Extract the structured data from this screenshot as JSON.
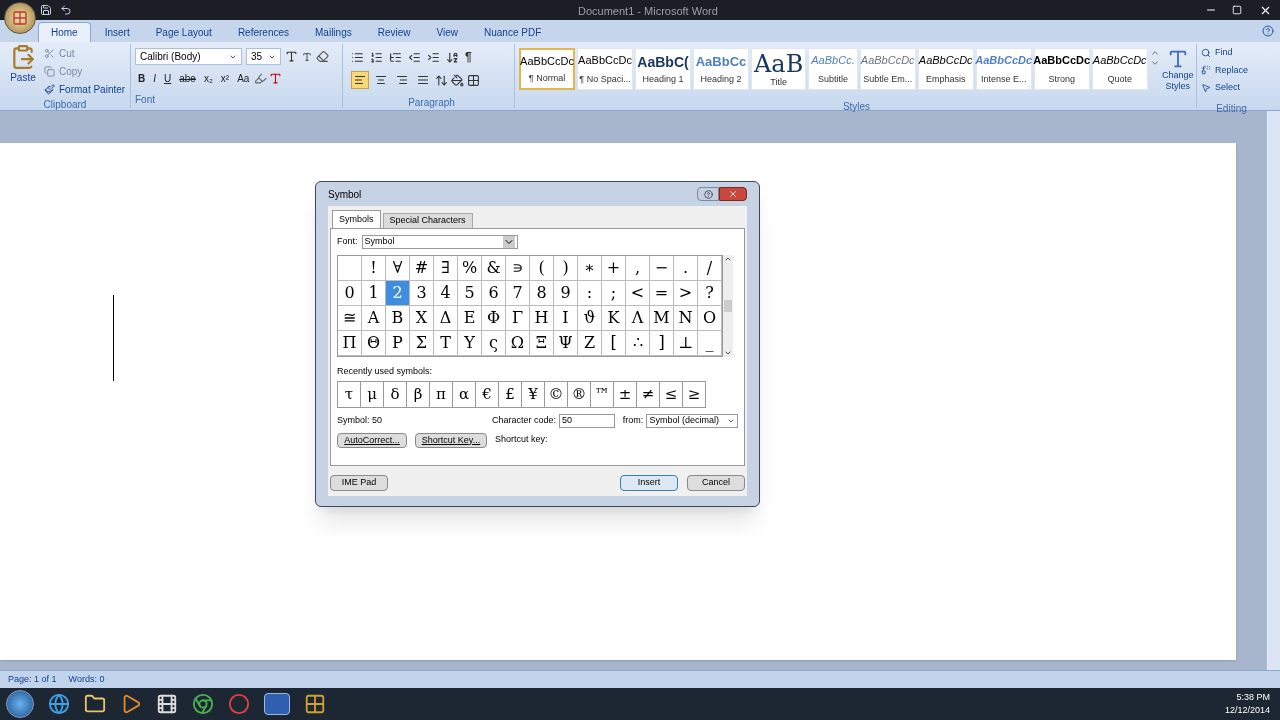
{
  "window": {
    "title": "Document1 - Microsoft Word"
  },
  "ribbon_tabs": [
    {
      "label": "Home",
      "selected": true
    },
    {
      "label": "Insert",
      "selected": false
    },
    {
      "label": "Page Layout",
      "selected": false
    },
    {
      "label": "References",
      "selected": false
    },
    {
      "label": "Mailings",
      "selected": false
    },
    {
      "label": "Review",
      "selected": false
    },
    {
      "label": "View",
      "selected": false
    },
    {
      "label": "Nuance PDF",
      "selected": false
    }
  ],
  "clipboard": {
    "label": "Clipboard",
    "paste": "Paste",
    "items": [
      "Cut",
      "Copy",
      "Format Painter"
    ]
  },
  "font": {
    "label": "Font",
    "name": "Calibri (Body)",
    "size": "35",
    "buttons": [
      "B",
      "I",
      "U",
      "abe",
      "x₂",
      "x²",
      "Aa"
    ]
  },
  "paragraph": {
    "label": "Paragraph",
    "alignment": [
      {
        "kind": "left",
        "selected": true
      },
      {
        "kind": "center",
        "selected": false
      },
      {
        "kind": "right",
        "selected": false
      },
      {
        "kind": "justify",
        "selected": false
      }
    ],
    "pilcrow": "¶"
  },
  "styles": {
    "label": "Styles",
    "items": [
      {
        "preview": "AaBbCcDc",
        "label": "¶ Normal",
        "kind": "normal",
        "selected": true
      },
      {
        "preview": "AaBbCcDc",
        "label": "¶ No Spaci...",
        "kind": "normal",
        "selected": false
      },
      {
        "preview": "AaBbC(",
        "label": "Heading 1",
        "kind": "heading1",
        "selected": false
      },
      {
        "preview": "AaBbCc",
        "label": "Heading 2",
        "kind": "heading2",
        "selected": false
      },
      {
        "preview": "AaB",
        "label": "Title",
        "kind": "title",
        "selected": false
      },
      {
        "preview": "AaBbCc.",
        "label": "Subtitle",
        "kind": "subtitle",
        "selected": false
      },
      {
        "preview": "AaBbCcDc",
        "label": "Subtle Em...",
        "kind": "subtle",
        "selected": false
      },
      {
        "preview": "AaBbCcDc",
        "label": "Emphasis",
        "kind": "emphasis",
        "selected": false
      },
      {
        "preview": "AaBbCcDc",
        "label": "Intense E...",
        "kind": "intense",
        "selected": false
      },
      {
        "preview": "AaBbCcDc",
        "label": "Strong",
        "kind": "strong",
        "selected": false
      },
      {
        "preview": "AaBbCcDc",
        "label": "Quote",
        "kind": "quote",
        "selected": false
      }
    ],
    "change": "Change Styles"
  },
  "editing": {
    "label": "Editing",
    "items": [
      "Find",
      "Replace",
      "Select"
    ]
  },
  "dialog": {
    "title": "Symbol",
    "tabs": [
      {
        "label": "Symbols",
        "selected": true
      },
      {
        "label": "Special Characters",
        "selected": false
      }
    ],
    "font_label": "Font:",
    "font_value": "Symbol",
    "grid": [
      [
        {
          "selected": false
        },
        {
          "c": "!",
          "selected": false
        },
        {
          "c": "∀",
          "selected": false
        },
        {
          "c": "#",
          "selected": false
        },
        {
          "c": "∃",
          "selected": false
        },
        {
          "c": "%",
          "selected": false
        },
        {
          "c": "&",
          "selected": false
        },
        {
          "c": "∍",
          "selected": false
        },
        {
          "c": "(",
          "selected": false
        },
        {
          "c": ")",
          "selected": false
        },
        {
          "c": "∗",
          "selected": false
        },
        {
          "c": "+",
          "selected": false
        },
        {
          "c": ",",
          "selected": false
        },
        {
          "c": "−",
          "selected": false
        },
        {
          "c": ".",
          "selected": false
        },
        {
          "c": "/",
          "selected": false
        }
      ],
      [
        {
          "c": "0",
          "selected": false
        },
        {
          "c": "1",
          "selected": false
        },
        {
          "c": "2",
          "selected": true
        },
        {
          "c": "3",
          "selected": false
        },
        {
          "c": "4",
          "selected": false
        },
        {
          "c": "5",
          "selected": false
        },
        {
          "c": "6",
          "selected": false
        },
        {
          "c": "7",
          "selected": false
        },
        {
          "c": "8",
          "selected": false
        },
        {
          "c": "9",
          "selected": false
        },
        {
          "c": ":",
          "selected": false
        },
        {
          "c": ";",
          "selected": false
        },
        {
          "c": "<",
          "selected": false
        },
        {
          "c": "=",
          "selected": false
        },
        {
          "c": ">",
          "selected": false
        },
        {
          "c": "?",
          "selected": false
        }
      ],
      [
        {
          "c": "≅",
          "selected": false
        },
        {
          "c": "Α",
          "selected": false
        },
        {
          "c": "Β",
          "selected": false
        },
        {
          "c": "Χ",
          "selected": false
        },
        {
          "c": "Δ",
          "selected": false
        },
        {
          "c": "Ε",
          "selected": false
        },
        {
          "c": "Φ",
          "selected": false
        },
        {
          "c": "Γ",
          "selected": false
        },
        {
          "c": "Η",
          "selected": false
        },
        {
          "c": "Ι",
          "selected": false
        },
        {
          "c": "ϑ",
          "selected": false
        },
        {
          "c": "Κ",
          "selected": false
        },
        {
          "c": "Λ",
          "selected": false
        },
        {
          "c": "Μ",
          "selected": false
        },
        {
          "c": "Ν",
          "selected": false
        },
        {
          "c": "Ο",
          "selected": false
        }
      ],
      [
        {
          "c": "Π",
          "selected": false
        },
        {
          "c": "Θ",
          "selected": false
        },
        {
          "c": "Ρ",
          "selected": false
        },
        {
          "c": "Σ",
          "selected": false
        },
        {
          "c": "Τ",
          "selected": false
        },
        {
          "c": "Υ",
          "selected": false
        },
        {
          "c": "ς",
          "selected": false
        },
        {
          "c": "Ω",
          "selected": false
        },
        {
          "c": "Ξ",
          "selected": false
        },
        {
          "c": "Ψ",
          "selected": false
        },
        {
          "c": "Ζ",
          "selected": false
        },
        {
          "c": "[",
          "selected": false
        },
        {
          "c": "∴",
          "selected": false
        },
        {
          "c": "]",
          "selected": false
        },
        {
          "c": "⊥",
          "selected": false
        },
        {
          "c": "_",
          "selected": false
        }
      ]
    ],
    "recent_label": "Recently used symbols:",
    "recent": [
      "τ",
      "μ",
      "δ",
      "β",
      "π",
      "α",
      "€",
      "£",
      "¥",
      "©",
      "®",
      "™",
      "±",
      "≠",
      "≤",
      "≥"
    ],
    "symbol_info": "Symbol: 50",
    "code_label": "Character code:",
    "code_value": "50",
    "from_label": "from:",
    "from_value": "Symbol (decimal)",
    "autocorrect": "AutoCorrect...",
    "shortcut_button": "Shortcut Key...",
    "shortcut_label": "Shortcut key:",
    "ime": "IME Pad",
    "insert": "Insert",
    "cancel": "Cancel"
  },
  "status_bar": {
    "page": "Page: 1 of 1",
    "words": "Words: 0"
  },
  "taskbar": {
    "time": "5:38 PM",
    "date": "12/12/2014"
  }
}
